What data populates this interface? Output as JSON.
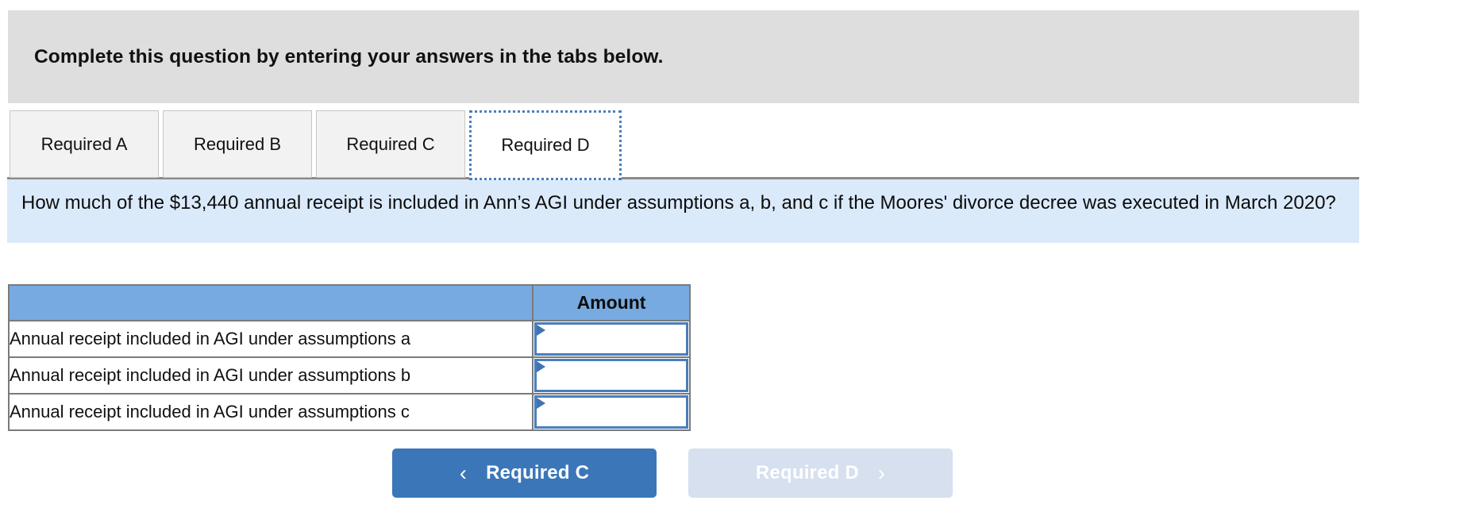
{
  "instruction": {
    "text": "Complete this question by entering your answers in the tabs below."
  },
  "tabs": [
    {
      "label": "Required A",
      "active": false
    },
    {
      "label": "Required B",
      "active": false
    },
    {
      "label": "Required C",
      "active": false
    },
    {
      "label": "Required D",
      "active": true
    }
  ],
  "prompt": {
    "text": "How much of the $13,440 annual receipt is included in Ann’s AGI under assumptions a, b, and c if the Moores' divorce decree was executed in March 2020?"
  },
  "table": {
    "headers": {
      "label_column": "",
      "amount_column": "Amount"
    },
    "rows": [
      {
        "label": "Annual receipt included in AGI under assumptions a",
        "amount": "",
        "placeholder": ""
      },
      {
        "label": "Annual receipt included in AGI under assumptions b",
        "amount": "",
        "placeholder": ""
      },
      {
        "label": "Annual receipt included in AGI under assumptions c",
        "amount": "",
        "placeholder": ""
      }
    ]
  },
  "navigation": {
    "prev": {
      "label": "Required C",
      "chevron": "‹"
    },
    "next": {
      "label": "Required D",
      "chevron": "›"
    }
  },
  "colors": {
    "band_gray": "#dedede",
    "prompt_blue": "#dbeafa",
    "table_header_blue": "#77aae0",
    "input_border_blue": "#4a7ebb",
    "primary_button_blue": "#3b77b8",
    "disabled_button_blue": "#d6e0ef",
    "tab_active_border": "#4a7ebb"
  }
}
